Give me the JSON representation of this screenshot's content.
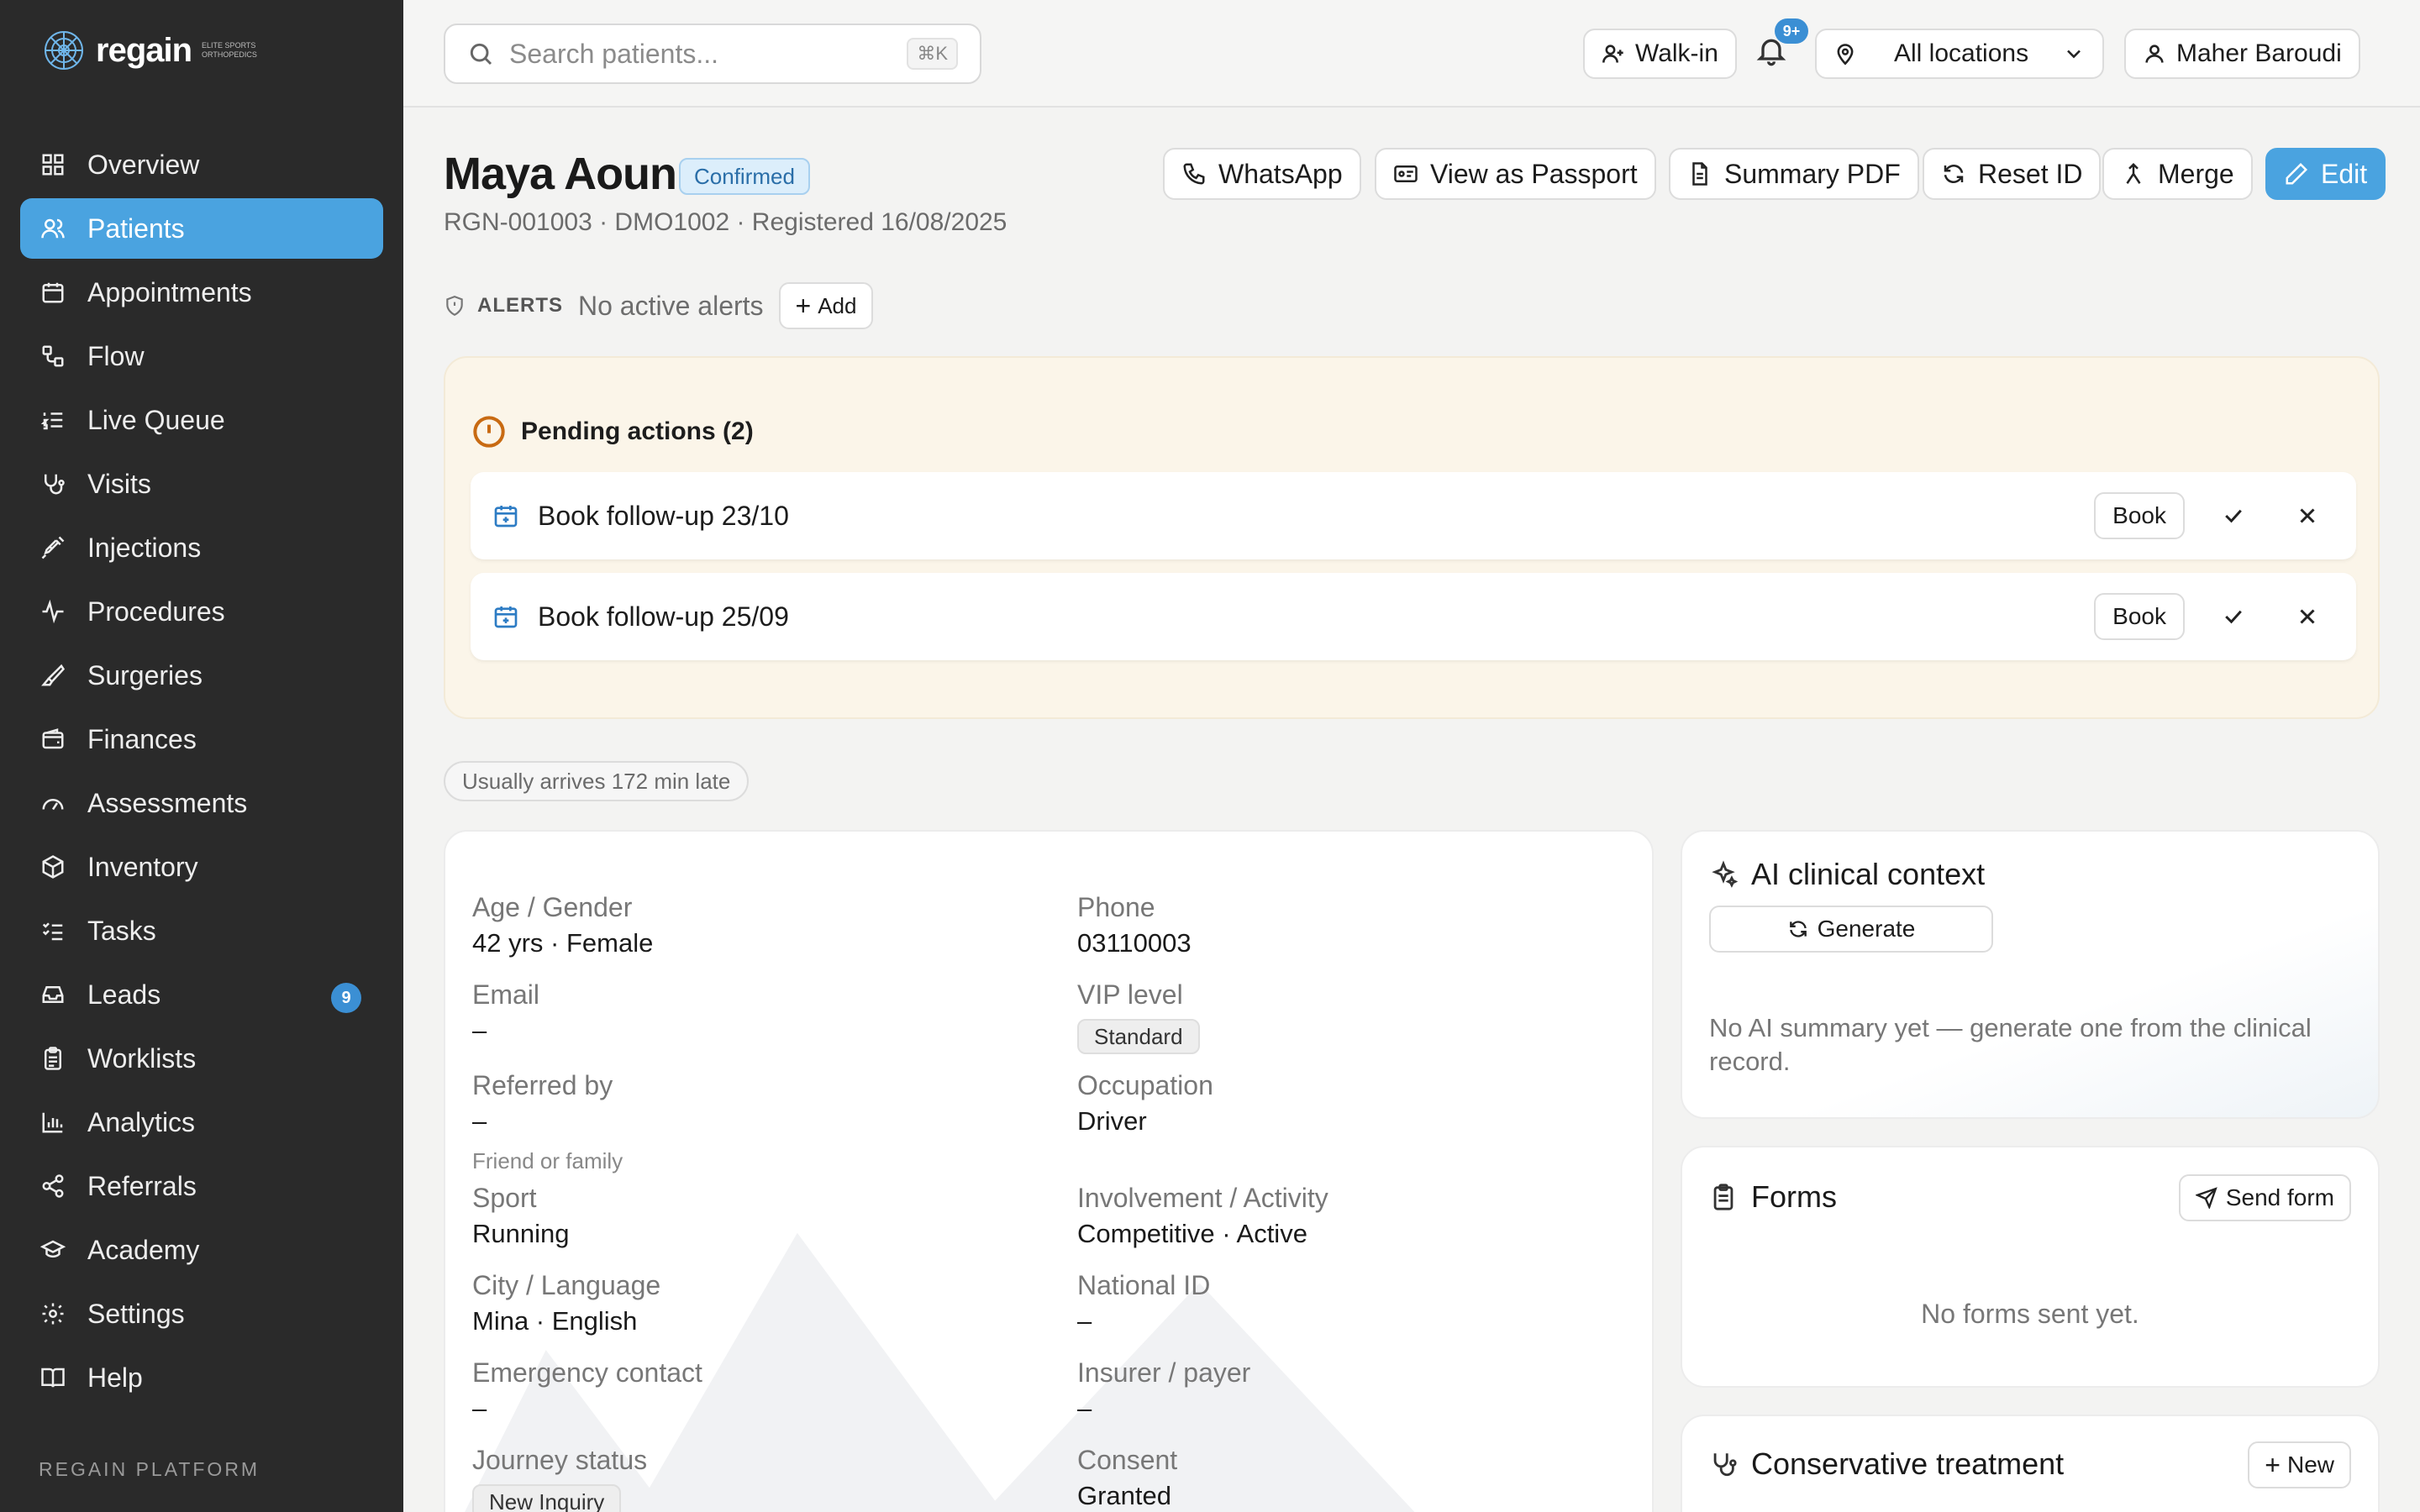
{
  "brand": {
    "name": "regain",
    "subtitle": "Elite Sports Orthopedics"
  },
  "sidebar": {
    "items": [
      {
        "label": "Overview",
        "icon": "grid-icon"
      },
      {
        "label": "Patients",
        "icon": "users-icon",
        "active": true
      },
      {
        "label": "Appointments",
        "icon": "calendar-icon"
      },
      {
        "label": "Flow",
        "icon": "flow-icon"
      },
      {
        "label": "Live Queue",
        "icon": "list-ordered-icon"
      },
      {
        "label": "Visits",
        "icon": "stethoscope-icon"
      },
      {
        "label": "Injections",
        "icon": "syringe-icon"
      },
      {
        "label": "Procedures",
        "icon": "activity-icon"
      },
      {
        "label": "Surgeries",
        "icon": "scalpel-icon"
      },
      {
        "label": "Finances",
        "icon": "wallet-icon"
      },
      {
        "label": "Assessments",
        "icon": "gauge-icon"
      },
      {
        "label": "Inventory",
        "icon": "package-icon"
      },
      {
        "label": "Tasks",
        "icon": "checklist-icon"
      },
      {
        "label": "Leads",
        "icon": "inbox-icon",
        "badge": "9"
      },
      {
        "label": "Worklists",
        "icon": "clipboard-icon"
      },
      {
        "label": "Analytics",
        "icon": "bar-chart-icon"
      },
      {
        "label": "Referrals",
        "icon": "share-icon"
      },
      {
        "label": "Academy",
        "icon": "graduation-cap-icon"
      },
      {
        "label": "Settings",
        "icon": "gear-icon"
      },
      {
        "label": "Help",
        "icon": "book-icon"
      }
    ],
    "footer": "REGAIN PLATFORM"
  },
  "topbar": {
    "search_placeholder": "Search patients...",
    "search_shortcut": "⌘K",
    "walkin_label": "Walk-in",
    "notif_badge": "9+",
    "location_label": "All locations",
    "user_name": "Maher Baroudi"
  },
  "patient": {
    "name": "Maya Aoun",
    "status": "Confirmed",
    "meta": "RGN-001003 · DMO1002 · Registered 16/08/2025"
  },
  "actions": {
    "whatsapp": "WhatsApp",
    "passport": "View as Passport",
    "summary": "Summary PDF",
    "reset": "Reset ID",
    "merge": "Merge",
    "edit": "Edit"
  },
  "alerts": {
    "label": "ALERTS",
    "text": "No active alerts",
    "add": "Add"
  },
  "pending": {
    "title": "Pending actions (2)",
    "rows": [
      {
        "label": "Book follow-up 23/10",
        "book": "Book"
      },
      {
        "label": "Book follow-up 25/09",
        "book": "Book"
      }
    ]
  },
  "late_note": "Usually arrives 172 min late",
  "demographics": {
    "age_gender": {
      "label": "Age / Gender",
      "value": "42 yrs · Female"
    },
    "phone": {
      "label": "Phone",
      "value": "03110003"
    },
    "email": {
      "label": "Email",
      "value": "–"
    },
    "vip": {
      "label": "VIP level",
      "value": "Standard"
    },
    "referred": {
      "label": "Referred by",
      "value": "–",
      "sub": "Friend or family"
    },
    "occupation": {
      "label": "Occupation",
      "value": "Driver"
    },
    "sport": {
      "label": "Sport",
      "value": "Running"
    },
    "involvement": {
      "label": "Involvement / Activity",
      "value": "Competitive · Active"
    },
    "city": {
      "label": "City / Language",
      "value": "Mina · English"
    },
    "national_id": {
      "label": "National ID",
      "value": "–"
    },
    "emergency": {
      "label": "Emergency contact",
      "value": "–"
    },
    "insurer": {
      "label": "Insurer / payer",
      "value": "–"
    },
    "journey": {
      "label": "Journey status",
      "value": "New Inquiry"
    },
    "consent": {
      "label": "Consent",
      "value": "Granted"
    }
  },
  "ai": {
    "title": "AI clinical context",
    "generate": "Generate",
    "empty": "No AI summary yet — generate one from the clinical record."
  },
  "forms": {
    "title": "Forms",
    "send": "Send form",
    "empty": "No forms sent yet."
  },
  "conservative": {
    "title": "Conservative treatment",
    "new": "New"
  }
}
